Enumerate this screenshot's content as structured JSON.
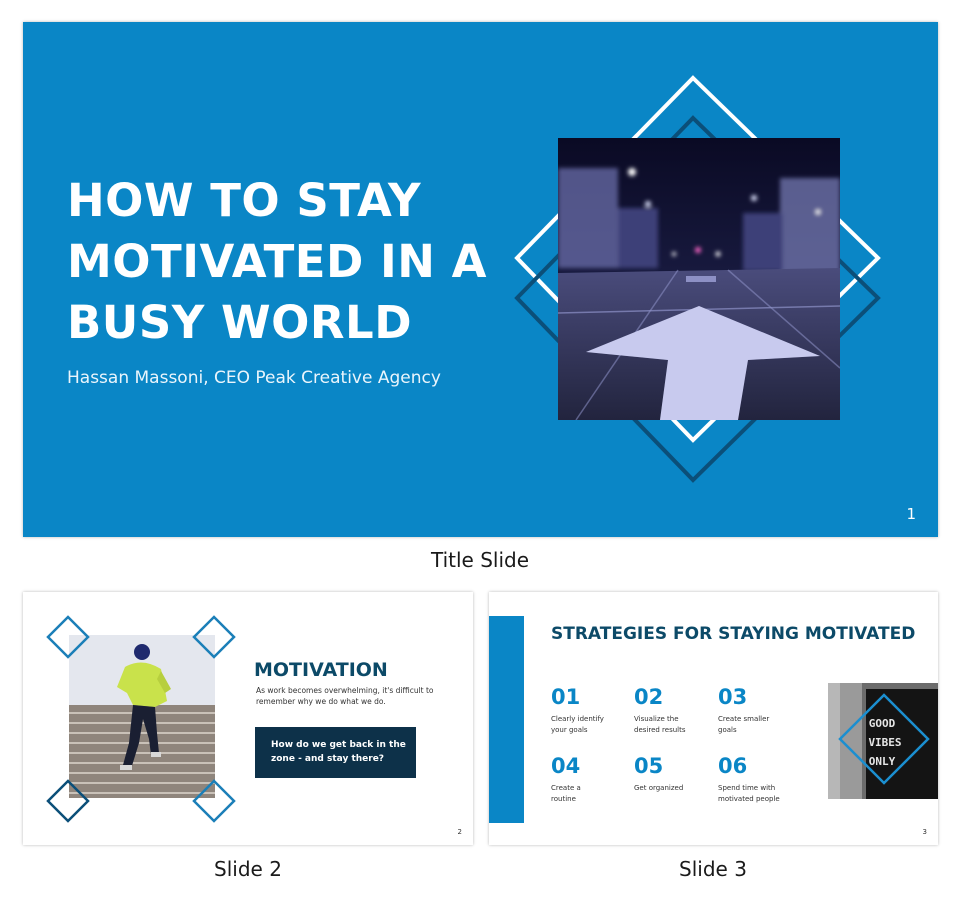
{
  "title_slide": {
    "title": "HOW TO STAY MOTIVATED IN A BUSY WORLD",
    "subtitle": "Hassan Massoni, CEO Peak Creative Agency",
    "page_number": "1",
    "caption": "Title Slide"
  },
  "slide2": {
    "title": "MOTIVATION",
    "text": "As work becomes overwhelming, it's difficult to remember why we do what we do.",
    "callout": "How do we get back in the zone - and stay there?",
    "page_number": "2",
    "caption": "Slide 2"
  },
  "slide3": {
    "title": "STRATEGIES FOR STAYING MOTIVATED",
    "strategies": [
      {
        "num": "01",
        "text": "Clearly identify your goals"
      },
      {
        "num": "02",
        "text": "Visualize the desired results"
      },
      {
        "num": "03",
        "text": "Create smaller goals"
      },
      {
        "num": "04",
        "text": "Create a routine"
      },
      {
        "num": "05",
        "text": "Get organized"
      },
      {
        "num": "06",
        "text": "Spend time with motivated people"
      }
    ],
    "photo_sign": [
      "GOOD",
      "VIBES",
      "ONLY"
    ],
    "page_number": "3",
    "caption": "Slide 3"
  },
  "colors": {
    "primary_blue": "#0a86c6",
    "dark_navy": "#0d3149",
    "title_navy": "#0c4a68"
  }
}
